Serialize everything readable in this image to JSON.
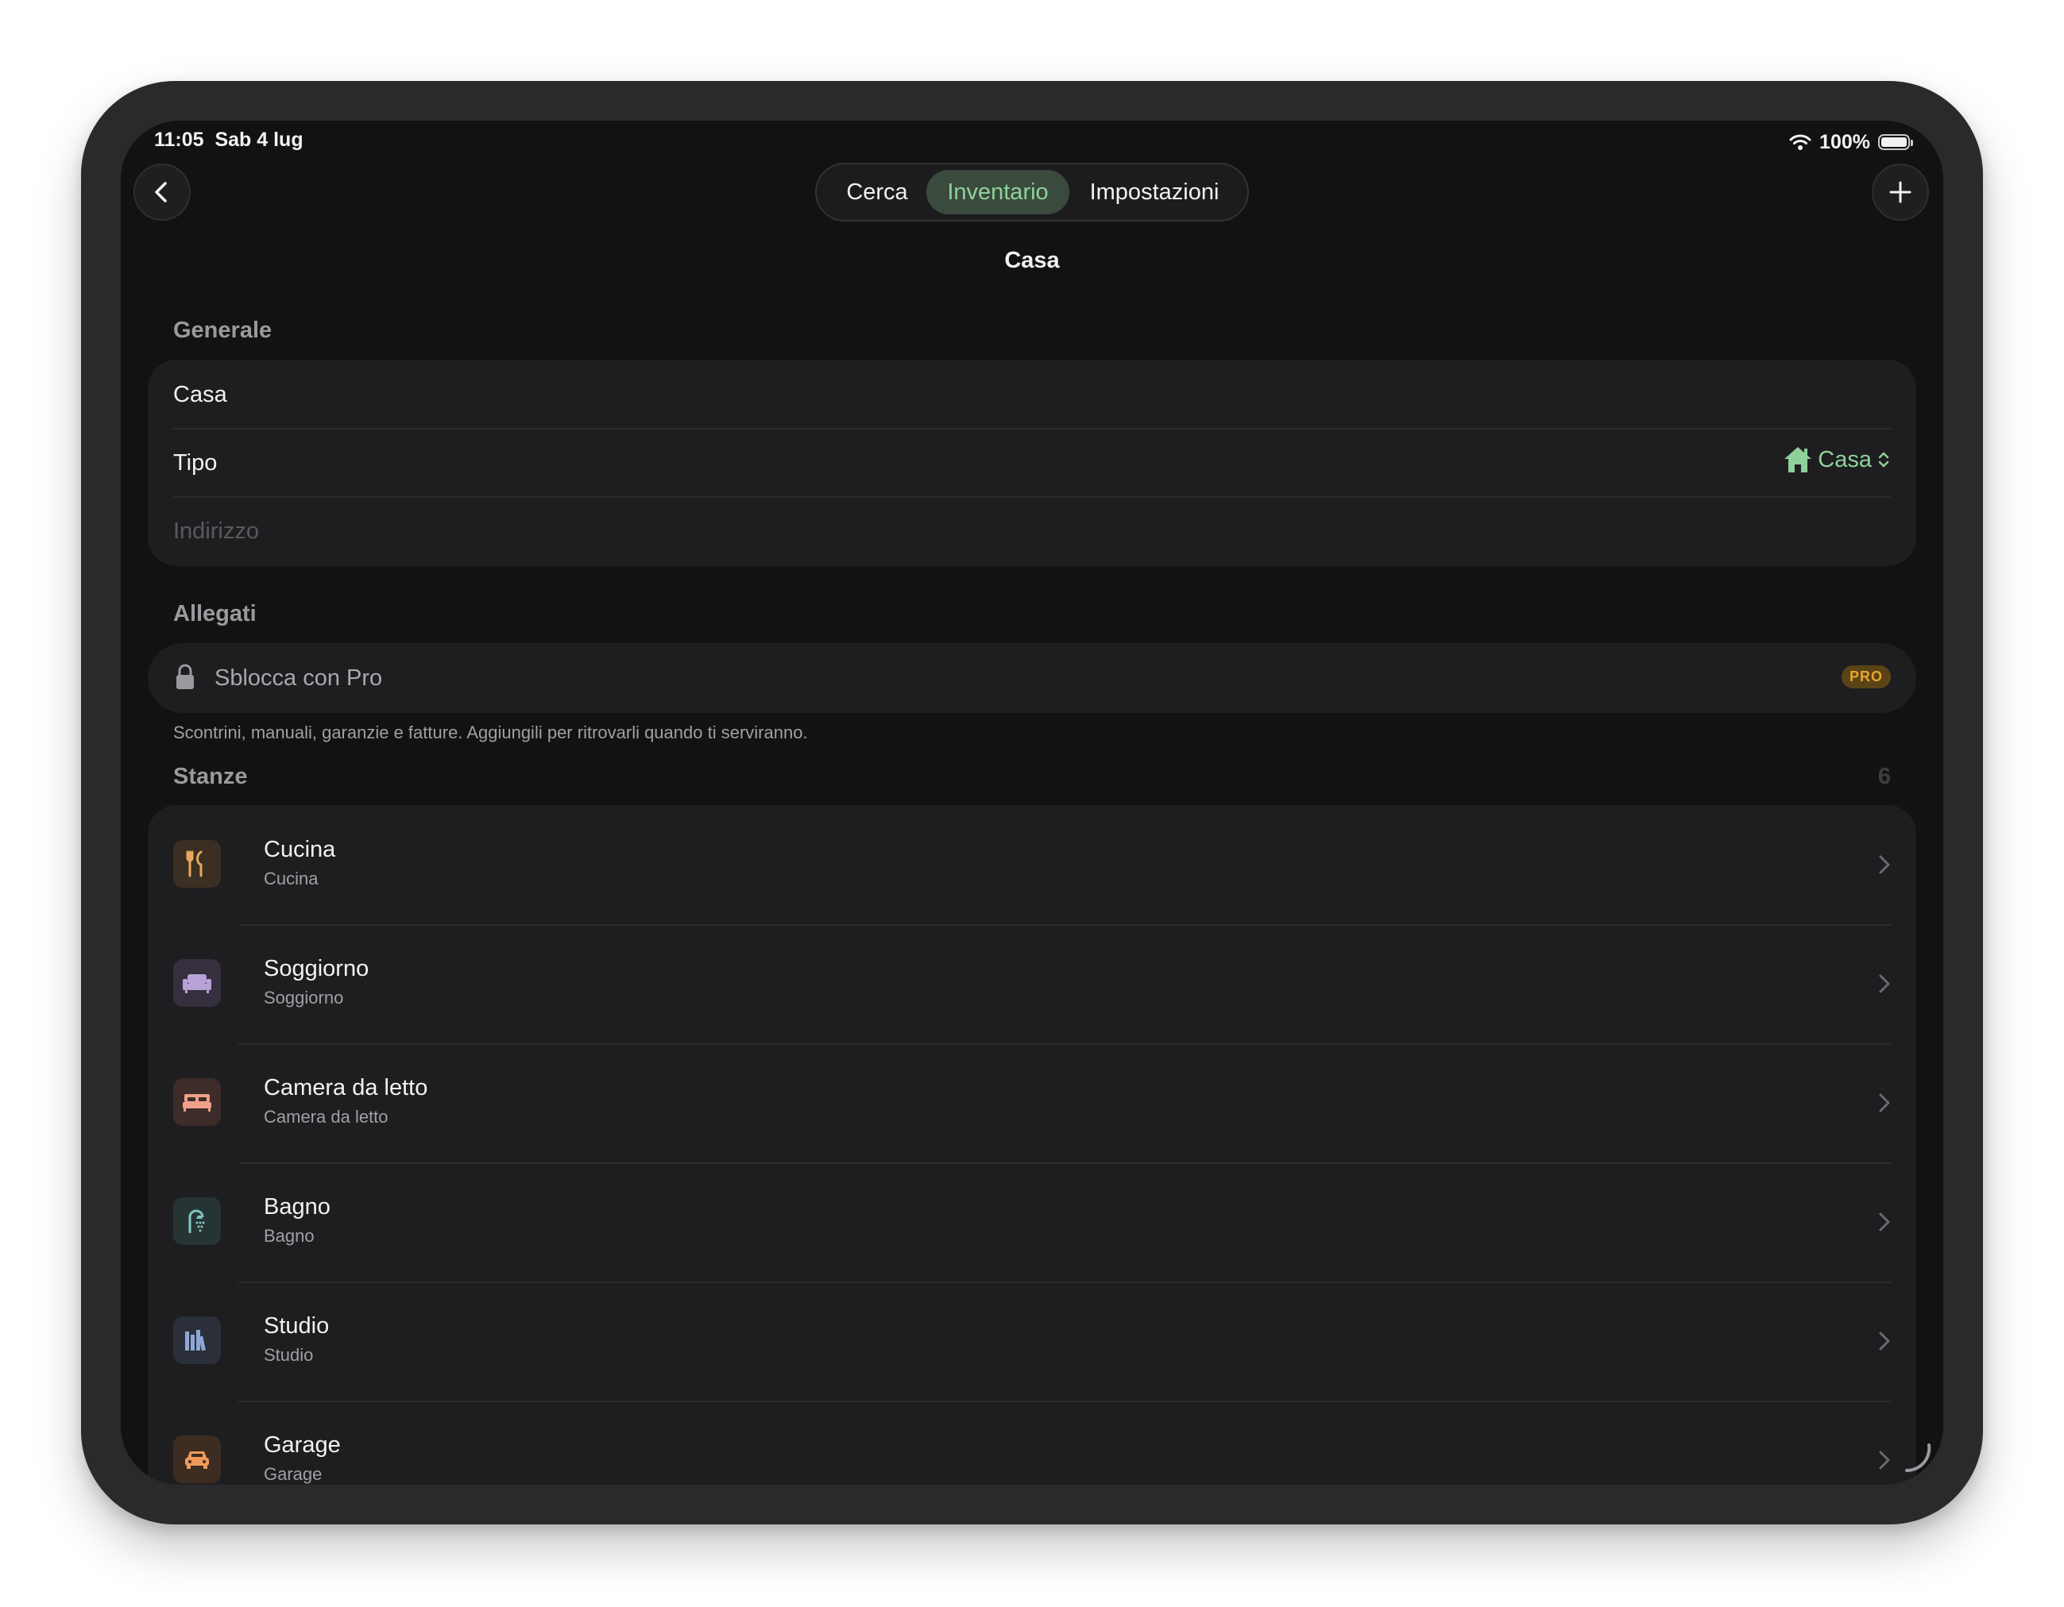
{
  "status_bar": {
    "time": "11:05",
    "date": "Sab 4 lug",
    "battery": "100%"
  },
  "nav": {
    "tabs": [
      {
        "label": "Cerca",
        "active": false
      },
      {
        "label": "Inventario",
        "active": true
      },
      {
        "label": "Impostazioni",
        "active": false
      }
    ],
    "title": "Casa",
    "back_icon": "chevron-left-icon",
    "add_icon": "plus-icon"
  },
  "generale": {
    "header": "Generale",
    "name_value": "Casa",
    "tipo_label": "Tipo",
    "tipo_value": "Casa",
    "address_placeholder": "Indirizzo"
  },
  "allegati": {
    "header": "Allegati",
    "unlock_label": "Sblocca con Pro",
    "badge": "PRO",
    "footnote": "Scontrini, manuali, garanzie e fatture. Aggiungili per ritrovarli quando ti serviranno."
  },
  "stanze": {
    "header": "Stanze",
    "count": "6",
    "items": [
      {
        "title": "Cucina",
        "subtitle": "Cucina",
        "icon": "fork-knife-icon",
        "color": "#e6a85a"
      },
      {
        "title": "Soggiorno",
        "subtitle": "Soggiorno",
        "icon": "sofa-icon",
        "color": "#b7a3d6"
      },
      {
        "title": "Camera da letto",
        "subtitle": "Camera da letto",
        "icon": "bed-icon",
        "color": "#f0a08a"
      },
      {
        "title": "Bagno",
        "subtitle": "Bagno",
        "icon": "shower-icon",
        "color": "#7fc6c0"
      },
      {
        "title": "Studio",
        "subtitle": "Studio",
        "icon": "books-icon",
        "color": "#8fa6d6"
      },
      {
        "title": "Garage",
        "subtitle": "Garage",
        "icon": "car-icon",
        "color": "#f09a5a"
      }
    ]
  },
  "colors": {
    "accent": "#8fd19b",
    "background": "#121212",
    "card": "#1e1e20",
    "pro": "#e9a431"
  }
}
